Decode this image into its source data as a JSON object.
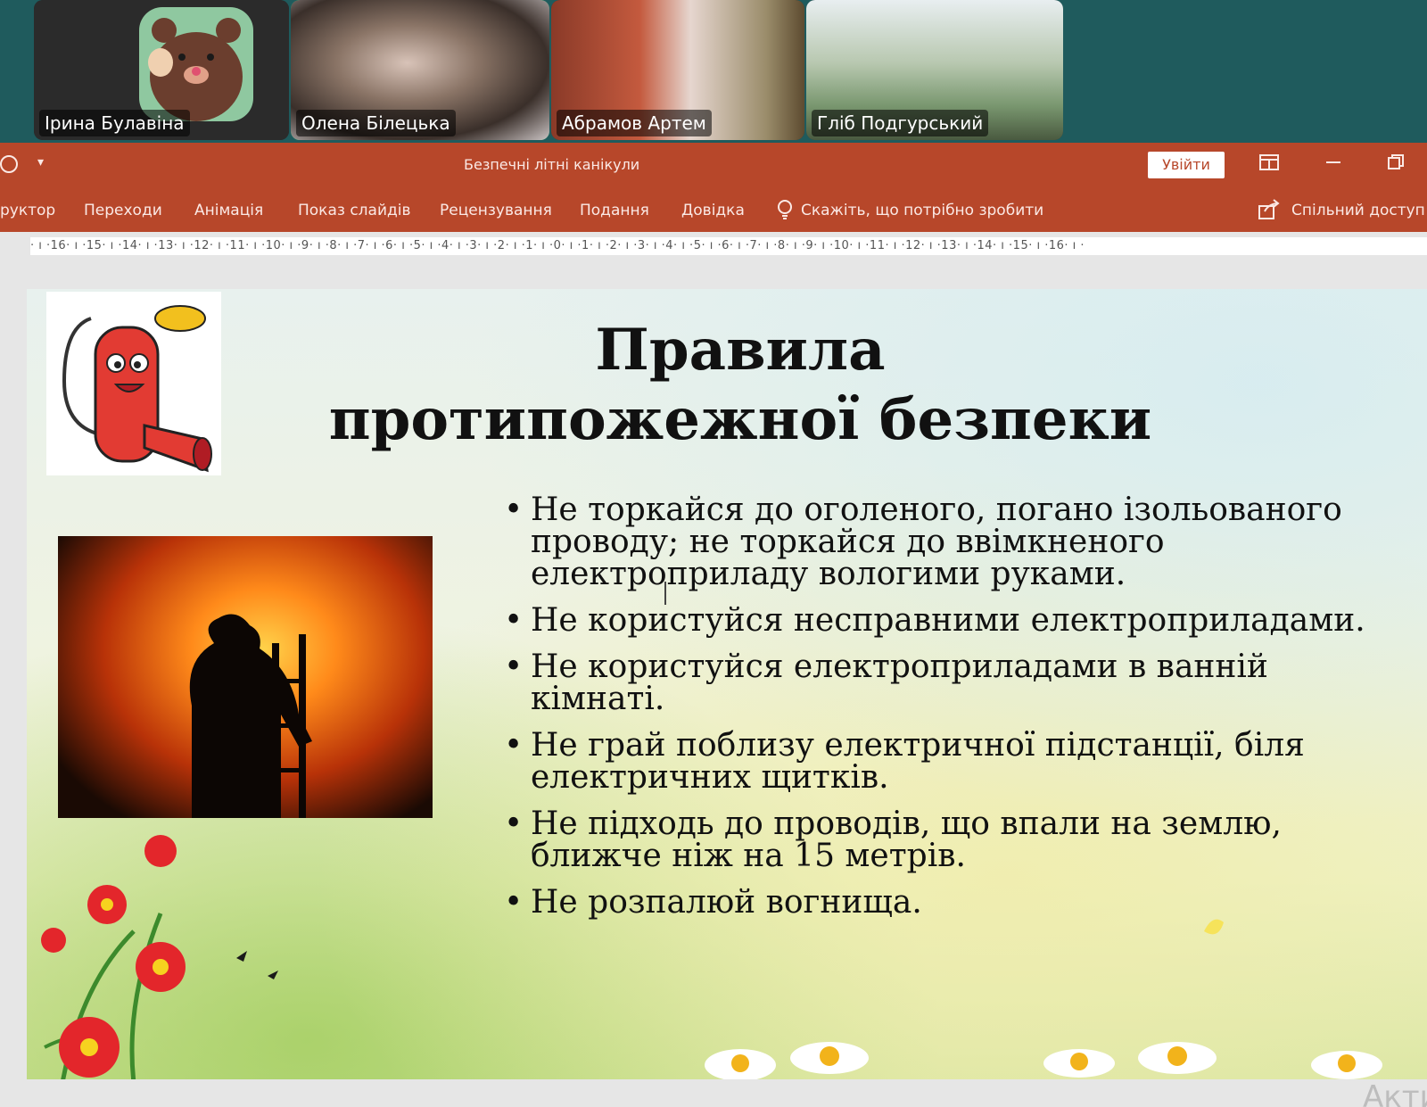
{
  "participants": [
    {
      "name": "Ірина Булавіна",
      "active": false
    },
    {
      "name": "Олена Білецька",
      "active": true
    },
    {
      "name": "Абрамов Артем",
      "active": false
    },
    {
      "name": "Гліб Подгурський",
      "active": false
    }
  ],
  "titlebar": {
    "document_title": "Безпечні літні канікули",
    "signin_label": "Увійти",
    "quick_access_dropdown": "▾"
  },
  "ribbon": {
    "tabs": [
      "руктор",
      "Переходи",
      "Анімація",
      "Показ слайдів",
      "Рецензування",
      "Подання",
      "Довідка"
    ],
    "tell_me": "Скажіть, що потрібно зробити",
    "share_label": "Спільний доступ"
  },
  "ruler": {
    "text": "· ı ·16· ı ·15· ı ·14· ı ·13· ı ·12· ı ·11· ı ·10· ı ·9· ı ·8· ı ·7· ı ·6· ı ·5· ı ·4· ı ·3· ı ·2· ı ·1· ı ·0· ı ·1· ı ·2· ı ·3· ı ·4· ı ·5· ı ·6· ı ·7· ı ·8· ı ·9· ı ·10· ı ·11· ı ·12· ı ·13· ı ·14· ı ·15· ı ·16· ı ·"
  },
  "slide": {
    "title_line1": "Правила",
    "title_line2": "протипожежної безпеки",
    "bullets": [
      "Не торкайся до оголеного, погано ізольованого проводу; не торкайся до ввімкненого електроприладу вологими руками.",
      "Не користуйся несправними електроприладами.",
      "Не користуйся електроприладами в ванній кімнаті.",
      "Не грай поблизу електричної підстанції, біля електричних щитків.",
      "Не підходь до проводів, що впали на землю, ближче ніж на 15 метрів.",
      "Не розпалюй вогнища."
    ]
  },
  "watermark": "Акти",
  "colors": {
    "ribbon": "#b7472a",
    "active_speaker": "#1ee07a",
    "meeting_bg": "#1f5b5d"
  },
  "icons": {
    "slideshow": "slideshow-icon",
    "lightbulb": "lightbulb-icon",
    "share": "share-icon",
    "minimize": "minimize-icon",
    "restore": "restore-icon",
    "ribbon_display": "ribbon-display-options-icon"
  }
}
